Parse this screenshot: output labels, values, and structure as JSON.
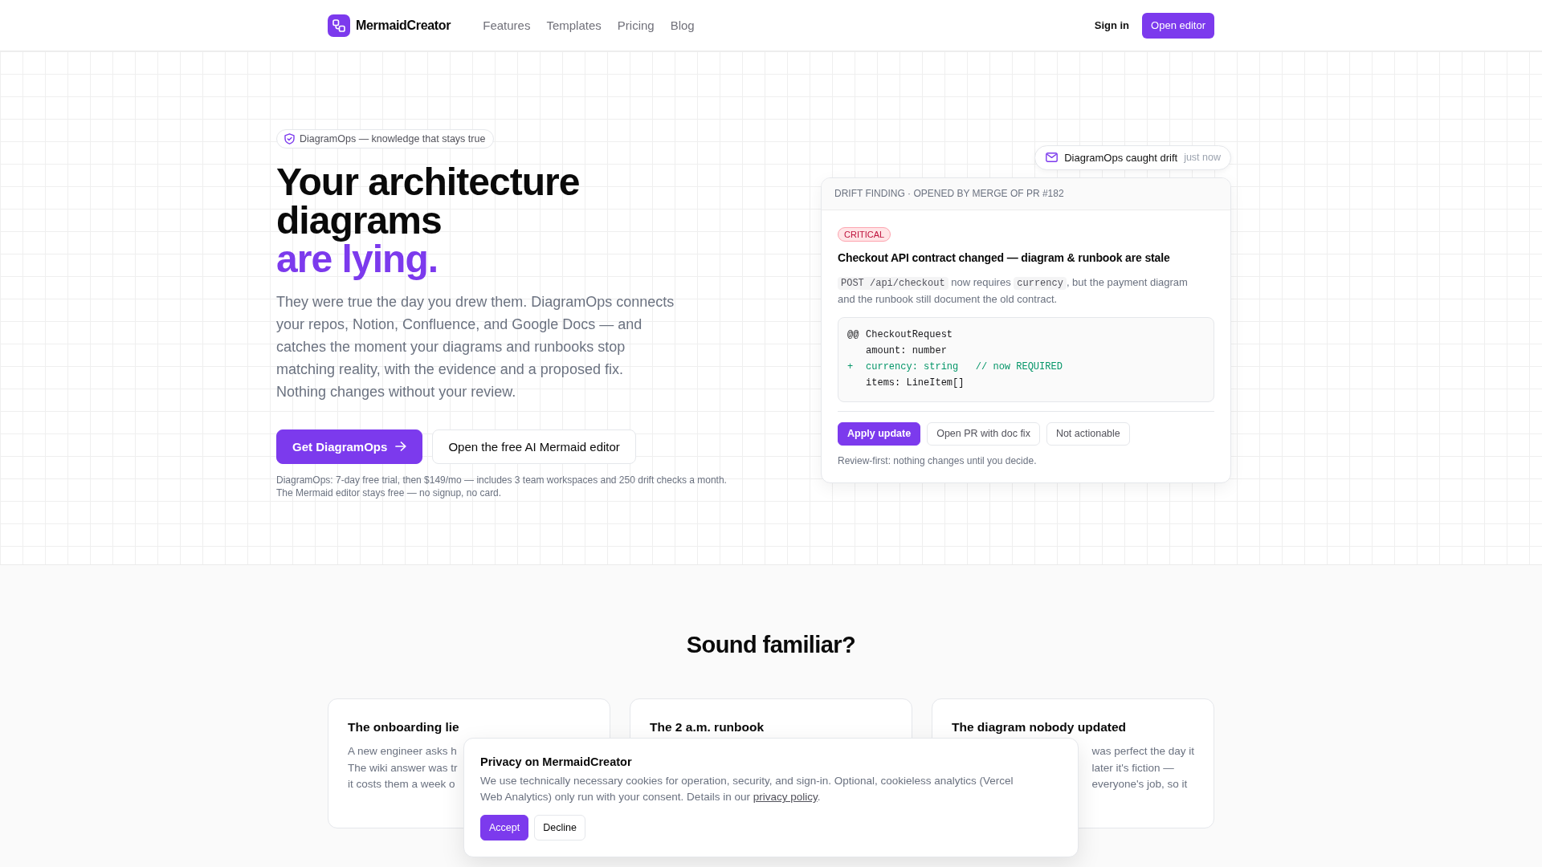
{
  "nav": {
    "brand": "MermaidCreator",
    "links": [
      "Features",
      "Templates",
      "Pricing",
      "Blog"
    ],
    "sign_in": "Sign in",
    "cta": "Open editor"
  },
  "hero": {
    "badge": "DiagramOps — knowledge that stays true",
    "headline": "Your architecture diagrams",
    "headline_accent": "are lying.",
    "description_lines": [
      "They were true the day you drew them. DiagramOps connects",
      "your repos, Notion, Confluence, and Google Docs — and",
      "catches the moment your diagrams and runbooks stop",
      "matching reality, with the evidence and a proposed fix.",
      "Nothing changes without your review."
    ],
    "buttons": [
      {
        "kind": "primary",
        "label": "Get DiagramOps"
      },
      {
        "kind": "secondary",
        "label": "Open the free AI Mermaid editor"
      }
    ],
    "note_lines": [
      "DiagramOps: 7-day free trial, then $149/mo — includes 3 team workspaces and 250 drift checks a month.",
      "The Mermaid editor stays free — no signup, no card."
    ]
  },
  "notification": {
    "title": "DiagramOps caught drift",
    "time": "just now"
  },
  "finding": {
    "header": "DRIFT FINDING · OPENED BY MERGE OF PR #182",
    "severity": {
      "kind": "critical",
      "label": "CRITICAL"
    },
    "title": "Checkout API contract changed — diagram & runbook are stale",
    "description": [
      {
        "kind": "code",
        "text": "POST /api/checkout"
      },
      {
        "kind": "text",
        "text": " now requires "
      },
      {
        "kind": "code",
        "text": "currency"
      },
      {
        "kind": "text",
        "text": ", but the payment diagram and the runbook still document the old contract."
      }
    ],
    "diff": [
      {
        "kind": "hunk",
        "marker": "@@",
        "text": "CheckoutRequest"
      },
      {
        "kind": "context",
        "text": "amount: number"
      },
      {
        "kind": "added",
        "marker": "+",
        "text": "currency: string   // now REQUIRED"
      },
      {
        "kind": "context",
        "text": "items: LineItem[]"
      }
    ],
    "actions": [
      {
        "kind": "primary",
        "label": "Apply update"
      },
      {
        "kind": "secondary",
        "label": "Open PR with doc fix"
      },
      {
        "kind": "secondary",
        "label": "Not actionable"
      }
    ],
    "note": "Review-first: nothing changes until you decide."
  },
  "problems": {
    "heading": "Sound familiar?",
    "cards": [
      {
        "title": "The onboarding lie",
        "lines": [
          "A new engineer asks h",
          "The wiki answer was tr",
          "it costs them a week o"
        ]
      },
      {
        "title": "The 2 a.m. runbook"
      },
      {
        "title": "The diagram nobody updated",
        "lines": [
          "was perfect the day it",
          "later it's fiction —",
          "everyone's job, so it"
        ]
      }
    ]
  },
  "cookie_banner": {
    "title": "Privacy on MermaidCreator",
    "message": [
      {
        "kind": "text",
        "text": "We use technically necessary cookies for operation, security, and sign-in. Optional, cookieless analytics (Vercel Web Analytics) only run with your consent. Details in our "
      },
      {
        "kind": "link",
        "text": "privacy policy"
      },
      {
        "kind": "text",
        "text": "."
      }
    ],
    "buttons": [
      {
        "kind": "primary",
        "label": "Accept"
      },
      {
        "kind": "secondary",
        "label": "Decline"
      }
    ]
  }
}
